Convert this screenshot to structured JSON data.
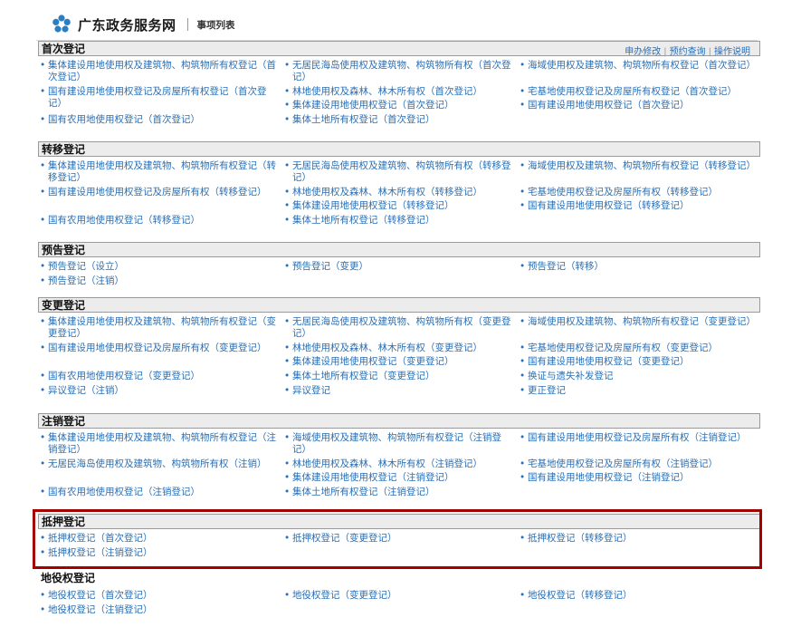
{
  "header": {
    "site_title": "广东政务服务网",
    "page_subtitle": "事项列表"
  },
  "header_links": [
    "申办修改",
    "预约查询",
    "操作说明"
  ],
  "sections": [
    {
      "title": "首次登记",
      "items": [
        "集体建设用地使用权及建筑物、构筑物所有权登记（首次登记）",
        "无居民海岛使用权及建筑物、构筑物所有权（首次登记）",
        "海域使用权及建筑物、构筑物所有权登记（首次登记）",
        "国有建设用地使用权登记及房屋所有权登记（首次登记）",
        "林地使用权及森林、林木所有权（首次登记）",
        "宅基地使用权登记及房屋所有权登记（首次登记）",
        "集体建设用地使用权登记（首次登记）",
        "国有建设用地使用权登记（首次登记）",
        "国有农用地使用权登记（首次登记）",
        "集体土地所有权登记（首次登记）"
      ]
    },
    {
      "title": "转移登记",
      "items": [
        "集体建设用地使用权及建筑物、构筑物所有权登记（转移登记）",
        "无居民海岛使用权及建筑物、构筑物所有权（转移登记）",
        "海域使用权及建筑物、构筑物所有权登记（转移登记）",
        "国有建设用地使用权登记及房屋所有权（转移登记）",
        "林地使用权及森林、林木所有权（转移登记）",
        "宅基地使用权登记及房屋所有权（转移登记）",
        "集体建设用地使用权登记（转移登记）",
        "国有建设用地使用权登记（转移登记）",
        "国有农用地使用权登记（转移登记）",
        "集体土地所有权登记（转移登记）"
      ]
    },
    {
      "title": "预告登记",
      "items": [
        "预告登记（设立）",
        "预告登记（变更）",
        "预告登记（转移）",
        "预告登记（注销）"
      ]
    },
    {
      "title": "变更登记",
      "items": [
        "集体建设用地使用权及建筑物、构筑物所有权登记（变更登记）",
        "无居民海岛使用权及建筑物、构筑物所有权（变更登记）",
        "海域使用权及建筑物、构筑物所有权登记（变更登记）",
        "国有建设用地使用权登记及房屋所有权（变更登记）",
        "林地使用权及森林、林木所有权（变更登记）",
        "宅基地使用权登记及房屋所有权（变更登记）",
        "集体建设用地使用权登记（变更登记）",
        "国有建设用地使用权登记（变更登记）",
        "国有农用地使用权登记（变更登记）",
        "集体土地所有权登记（变更登记）",
        "换证与遗失补发登记",
        "异议登记（注销）",
        "异议登记",
        "更正登记"
      ]
    },
    {
      "title": "注销登记",
      "items": [
        "集体建设用地使用权及建筑物、构筑物所有权登记（注销登记）",
        "海域使用权及建筑物、构筑物所有权登记（注销登记）",
        "国有建设用地使用权登记及房屋所有权（注销登记）",
        "无居民海岛使用权及建筑物、构筑物所有权（注销）",
        "林地使用权及森林、林木所有权（注销登记）",
        "宅基地使用权登记及房屋所有权（注销登记）",
        "集体建设用地使用权登记（注销登记）",
        "国有建设用地使用权登记（注销登记）",
        "国有农用地使用权登记（注销登记）",
        "集体土地所有权登记（注销登记）"
      ]
    },
    {
      "title": "抵押登记",
      "items": [
        "抵押权登记（首次登记）",
        "抵押权登记（变更登记）",
        "抵押权登记（转移登记）",
        "抵押权登记（注销登记）"
      ]
    },
    {
      "title": "地役权登记",
      "items": [
        "地役权登记（首次登记）",
        "地役权登记（变更登记）",
        "地役权登记（转移登记）",
        "地役权登记（注销登记）"
      ]
    }
  ]
}
